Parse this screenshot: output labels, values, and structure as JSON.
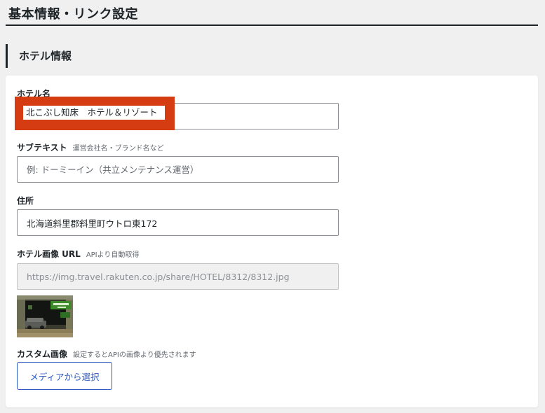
{
  "page": {
    "title": "基本情報・リンク設定"
  },
  "section": {
    "heading": "ホテル情報"
  },
  "fields": {
    "hotel_name": {
      "label": "ホテル名",
      "value": "北こぶし知床　ホテル＆リゾート"
    },
    "subtext": {
      "label": "サブテキスト",
      "hint": "運営会社名・ブランド名など",
      "value": "",
      "placeholder": "例: ドーミーイン（共立メンテナンス運営）"
    },
    "address": {
      "label": "住所",
      "value": "北海道斜里郡斜里町ウトロ東172"
    },
    "image_url": {
      "label": "ホテル画像 URL",
      "hint": "APIより自動取得",
      "value": "https://img.travel.rakuten.co.jp/share/HOTEL/8312/8312.jpg"
    },
    "custom_image": {
      "label": "カスタム画像",
      "hint": "設定するとAPIの画像より優先されます",
      "button_label": "メディアから選択"
    }
  },
  "colors": {
    "accent": "#2c59bd",
    "highlight": "#d63c12",
    "background": "#f0f0f1"
  }
}
